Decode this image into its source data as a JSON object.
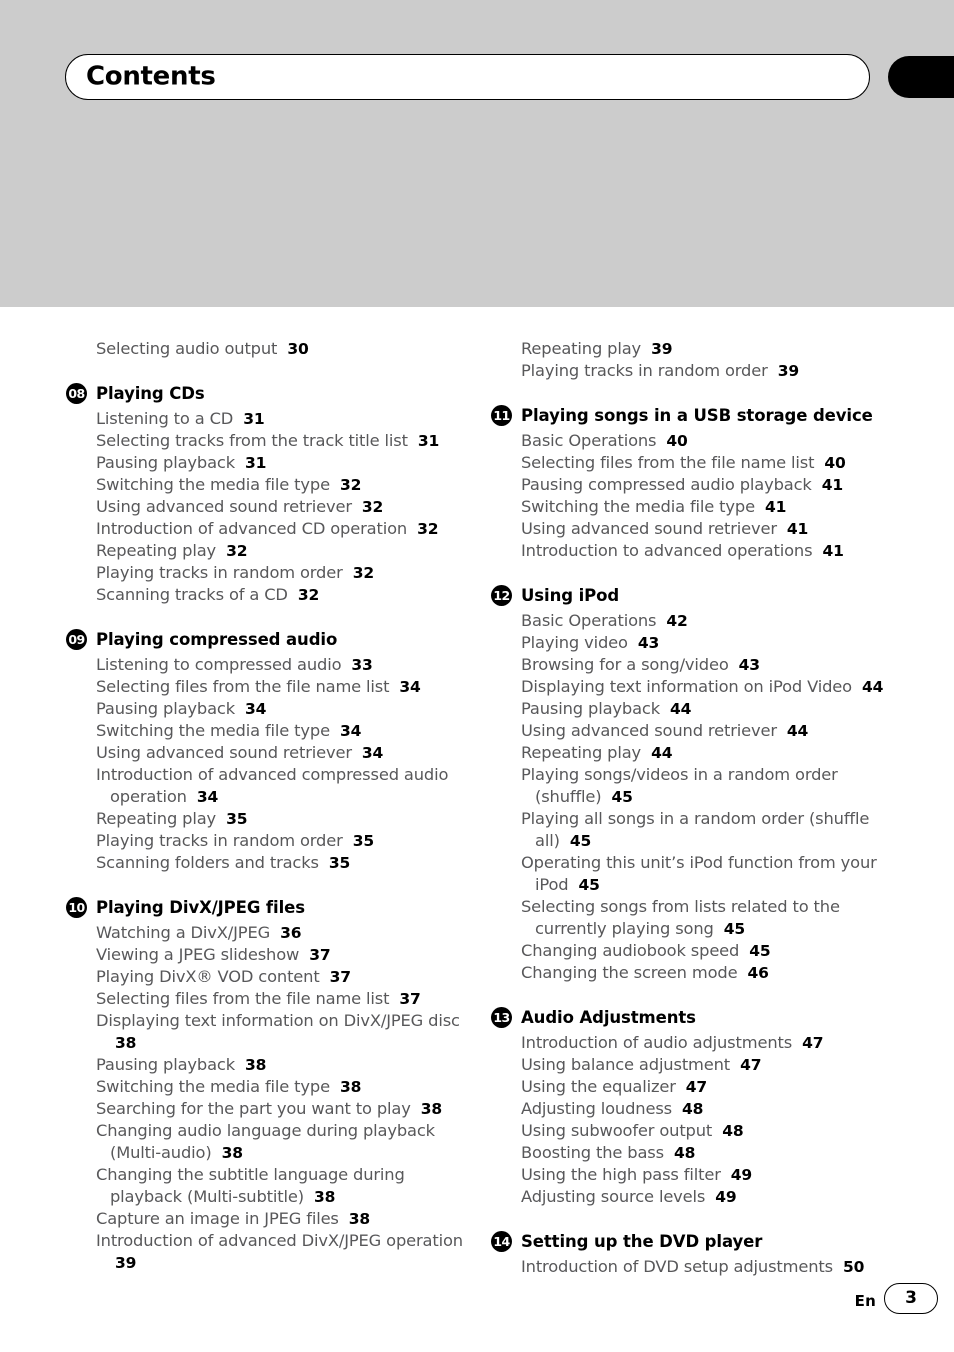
{
  "page": {
    "title": "Contents",
    "language_code": "En",
    "page_number": "3"
  },
  "columns": {
    "left": {
      "loose_entries": [
        {
          "label": "Selecting audio output",
          "page": "30"
        }
      ],
      "chapters": [
        {
          "number": "08",
          "title": "Playing CDs",
          "entries": [
            {
              "label": "Listening to a CD",
              "page": "31"
            },
            {
              "label": "Selecting tracks from the track title list",
              "page": "31"
            },
            {
              "label": "Pausing playback",
              "page": "31"
            },
            {
              "label": "Switching the media file type",
              "page": "32"
            },
            {
              "label": "Using advanced sound retriever",
              "page": "32"
            },
            {
              "label": "Introduction of advanced CD operation",
              "page": "32"
            },
            {
              "label": "Repeating play",
              "page": "32"
            },
            {
              "label": "Playing tracks in random order",
              "page": "32"
            },
            {
              "label": "Scanning tracks of a CD",
              "page": "32"
            }
          ]
        },
        {
          "number": "09",
          "title": "Playing compressed audio",
          "entries": [
            {
              "label": "Listening to compressed audio",
              "page": "33"
            },
            {
              "label": "Selecting files from the file name list",
              "page": "34"
            },
            {
              "label": "Pausing playback",
              "page": "34"
            },
            {
              "label": "Switching the media file type",
              "page": "34"
            },
            {
              "label": "Using advanced sound retriever",
              "page": "34"
            },
            {
              "label": "Introduction of advanced compressed audio operation",
              "page": "34"
            },
            {
              "label": "Repeating play",
              "page": "35"
            },
            {
              "label": "Playing tracks in random order",
              "page": "35"
            },
            {
              "label": "Scanning folders and tracks",
              "page": "35"
            }
          ]
        },
        {
          "number": "10",
          "title": "Playing DivX/JPEG files",
          "entries": [
            {
              "label": "Watching a DivX/JPEG",
              "page": "36"
            },
            {
              "label": "Viewing a JPEG slideshow",
              "page": "37"
            },
            {
              "label": "Playing DivX® VOD content",
              "page": "37"
            },
            {
              "label": "Selecting files from the file name list",
              "page": "37"
            },
            {
              "label": "Displaying text information on DivX/JPEG disc",
              "page": "38"
            },
            {
              "label": "Pausing playback",
              "page": "38"
            },
            {
              "label": "Switching the media file type",
              "page": "38"
            },
            {
              "label": "Searching for the part you want to play",
              "page": "38"
            },
            {
              "label": "Changing audio language during playback (Multi-audio)",
              "page": "38"
            },
            {
              "label": "Changing the subtitle language during playback (Multi-subtitle)",
              "page": "38"
            },
            {
              "label": "Capture an image in JPEG files",
              "page": "38"
            },
            {
              "label": "Introduction of advanced DivX/JPEG operation",
              "page": "39"
            }
          ]
        }
      ]
    },
    "right": {
      "loose_entries": [
        {
          "label": "Repeating play",
          "page": "39"
        },
        {
          "label": "Playing tracks in random order",
          "page": "39"
        }
      ],
      "chapters": [
        {
          "number": "11",
          "title": "Playing songs in a USB storage device",
          "entries": [
            {
              "label": "Basic Operations",
              "page": "40"
            },
            {
              "label": "Selecting files from the file name list",
              "page": "40"
            },
            {
              "label": "Pausing compressed audio playback",
              "page": "41"
            },
            {
              "label": "Switching the media file type",
              "page": "41"
            },
            {
              "label": "Using advanced sound retriever",
              "page": "41"
            },
            {
              "label": "Introduction to advanced operations",
              "page": "41"
            }
          ]
        },
        {
          "number": "12",
          "title": "Using iPod",
          "entries": [
            {
              "label": "Basic Operations",
              "page": "42"
            },
            {
              "label": "Playing video",
              "page": "43"
            },
            {
              "label": "Browsing for a song/video",
              "page": "43"
            },
            {
              "label": "Displaying text information on iPod Video",
              "page": "44"
            },
            {
              "label": "Pausing playback",
              "page": "44"
            },
            {
              "label": "Using advanced sound retriever",
              "page": "44"
            },
            {
              "label": "Repeating play",
              "page": "44"
            },
            {
              "label": "Playing songs/videos in a random order (shuffle)",
              "page": "45"
            },
            {
              "label": "Playing all songs in a random order (shuffle all)",
              "page": "45"
            },
            {
              "label": "Operating this unit’s iPod function from your iPod",
              "page": "45"
            },
            {
              "label": "Selecting songs from lists related to the currently playing song",
              "page": "45"
            },
            {
              "label": "Changing audiobook speed",
              "page": "45"
            },
            {
              "label": "Changing the screen mode",
              "page": "46"
            }
          ]
        },
        {
          "number": "13",
          "title": "Audio Adjustments",
          "entries": [
            {
              "label": "Introduction of audio adjustments",
              "page": "47"
            },
            {
              "label": "Using balance adjustment",
              "page": "47"
            },
            {
              "label": "Using the equalizer",
              "page": "47"
            },
            {
              "label": "Adjusting loudness",
              "page": "48"
            },
            {
              "label": "Using subwoofer output",
              "page": "48"
            },
            {
              "label": "Boosting the bass",
              "page": "48"
            },
            {
              "label": "Using the high pass filter",
              "page": "49"
            },
            {
              "label": "Adjusting source levels",
              "page": "49"
            }
          ]
        },
        {
          "number": "14",
          "title": "Setting up the DVD player",
          "entries": [
            {
              "label": "Introduction of DVD setup adjustments",
              "page": "50"
            }
          ]
        }
      ]
    }
  }
}
